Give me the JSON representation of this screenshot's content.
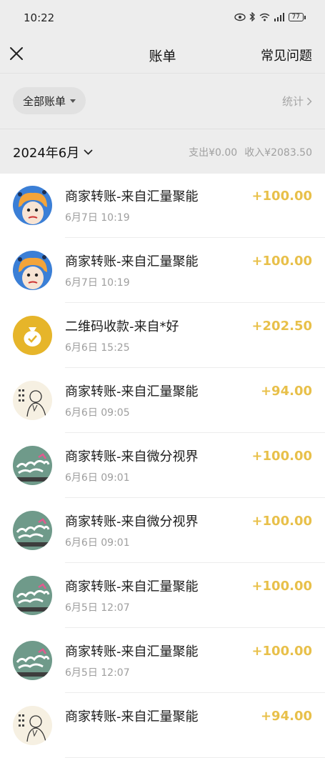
{
  "status": {
    "time": "10:22",
    "battery": "77"
  },
  "nav": {
    "title": "账单",
    "faq": "常见问题"
  },
  "filter": {
    "chip_label": "全部账单",
    "stats_label": "统计"
  },
  "month": {
    "label": "2024年6月",
    "expense": "支出¥0.00",
    "income": "收入¥2083.50"
  },
  "colors": {
    "amount": "#e8c04a",
    "background": "#ededed"
  },
  "transactions": [
    {
      "title": "商家转账-来自汇量聚能",
      "time": "6月7日 10:19",
      "amount": "+100.00",
      "avatar": "cartoon-head-avatar"
    },
    {
      "title": "商家转账-来自汇量聚能",
      "time": "6月7日 10:19",
      "amount": "+100.00",
      "avatar": "cartoon-head-avatar"
    },
    {
      "title": "二维码收款-来自*好",
      "time": "6月6日 15:25",
      "amount": "+202.50",
      "avatar": "money-bag-icon"
    },
    {
      "title": "商家转账-来自汇量聚能",
      "time": "6月6日 09:05",
      "amount": "+94.00",
      "avatar": "sketch-portrait-avatar"
    },
    {
      "title": "商家转账-来自微分视界",
      "time": "6月6日 09:01",
      "amount": "+100.00",
      "avatar": "green-logo-avatar"
    },
    {
      "title": "商家转账-来自微分视界",
      "time": "6月6日 09:01",
      "amount": "+100.00",
      "avatar": "green-logo-avatar"
    },
    {
      "title": "商家转账-来自汇量聚能",
      "time": "6月5日 12:07",
      "amount": "+100.00",
      "avatar": "green-logo-avatar"
    },
    {
      "title": "商家转账-来自汇量聚能",
      "time": "6月5日 12:07",
      "amount": "+100.00",
      "avatar": "green-logo-avatar"
    },
    {
      "title": "商家转账-来自汇量聚能",
      "time": "",
      "amount": "+94.00",
      "avatar": "sketch-portrait-avatar"
    }
  ]
}
